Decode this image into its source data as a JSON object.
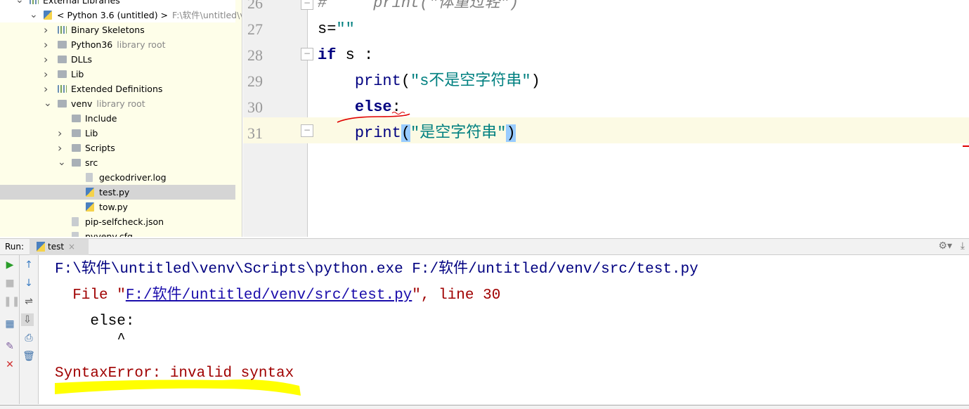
{
  "project_tree": [
    {
      "label": "External Libraries",
      "indent": 0,
      "chev": "v",
      "icon": "library-icon"
    },
    {
      "label": "< Python 3.6 (untitled) >",
      "hint": "F:\\软件\\untitled\\venv\\Scripts",
      "indent": 1,
      "chev": "v",
      "icon": "python-icon"
    },
    {
      "label": "Binary Skeletons",
      "indent": 2,
      "chev": ">",
      "icon": "library-icon"
    },
    {
      "label": "Python36",
      "hint": "library root",
      "indent": 2,
      "chev": ">",
      "icon": "folder-icon"
    },
    {
      "label": "DLLs",
      "indent": 2,
      "chev": ">",
      "icon": "folder-icon"
    },
    {
      "label": "Lib",
      "indent": 2,
      "chev": ">",
      "icon": "folder-icon"
    },
    {
      "label": "Extended Definitions",
      "indent": 2,
      "chev": ">",
      "icon": "library-icon"
    },
    {
      "label": "venv",
      "hint": "library root",
      "indent": 2,
      "chev": "v",
      "icon": "folder-icon"
    },
    {
      "label": "Include",
      "indent": 3,
      "chev": "",
      "icon": "folder-icon"
    },
    {
      "label": "Lib",
      "indent": 3,
      "chev": ">",
      "icon": "folder-icon"
    },
    {
      "label": "Scripts",
      "indent": 3,
      "chev": ">",
      "icon": "folder-icon"
    },
    {
      "label": "src",
      "indent": 3,
      "chev": "v",
      "icon": "folder-icon"
    },
    {
      "label": "geckodriver.log",
      "indent": 4,
      "chev": "",
      "icon": "text-file-icon"
    },
    {
      "label": "test.py",
      "indent": 4,
      "chev": "",
      "icon": "python-file-icon",
      "selected": true
    },
    {
      "label": "tow.py",
      "indent": 4,
      "chev": "",
      "icon": "python-file-icon"
    },
    {
      "label": "pip-selfcheck.json",
      "indent": 3,
      "chev": "",
      "icon": "json-file-icon"
    },
    {
      "label": "pyvenv.cfg",
      "indent": 3,
      "chev": "",
      "icon": "config-file-icon"
    }
  ],
  "editor": {
    "lines": [
      {
        "n": "26",
        "parts": [
          [
            "cm",
            "#     print(\"体重过轻\")"
          ]
        ]
      },
      {
        "n": "27",
        "parts": [
          [
            "",
            "s="
          ],
          [
            "str",
            "\"\""
          ]
        ]
      },
      {
        "n": "28",
        "parts": [
          [
            "kw",
            "if"
          ],
          [
            "",
            " s :"
          ]
        ]
      },
      {
        "n": "29",
        "parts": [
          [
            "",
            "    "
          ],
          [
            "fn",
            "print"
          ],
          [
            "",
            "("
          ],
          [
            "str",
            "\"s不是空字符串\""
          ],
          [
            "",
            ")"
          ]
        ]
      },
      {
        "n": "30",
        "parts": [
          [
            "",
            "    "
          ],
          [
            "kw",
            "else"
          ],
          [
            "",
            ":"
          ]
        ]
      },
      {
        "n": "31",
        "parts": [
          [
            "",
            "    "
          ],
          [
            "fn",
            "print"
          ],
          [
            "brace",
            "("
          ],
          [
            "str",
            "\"是空字符串\""
          ],
          [
            "brace",
            ")"
          ]
        ]
      }
    ]
  },
  "run": {
    "label": "Run:",
    "tab": "test",
    "console": {
      "cmd": "F:\\软件\\untitled\\venv\\Scripts\\python.exe F:/软件/untitled/venv/src/test.py",
      "file_prefix": "  File \"",
      "file_link": "F:/软件/untitled/venv/src/test.py",
      "file_suffix": "\", line 30",
      "code": "    else:",
      "caret": "       ^",
      "error": "SyntaxError: invalid syntax"
    }
  },
  "colors": {
    "annotation_highlight": "#ffff00",
    "annotation_red": "#e00000"
  }
}
